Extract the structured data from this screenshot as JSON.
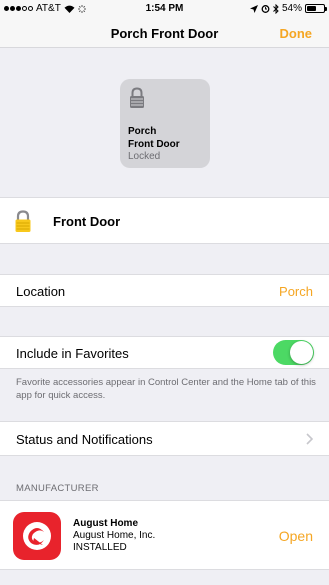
{
  "status_bar": {
    "carrier": "AT&T",
    "time": "1:54 PM",
    "battery": "54%",
    "battery_level": 0.54,
    "icons": [
      "signal-dots-icon",
      "wifi-icon",
      "activity-spinner-icon",
      "location-arrow-icon",
      "alarm-icon",
      "bluetooth-icon",
      "battery-icon"
    ]
  },
  "nav": {
    "title": "Porch Front Door",
    "done_label": "Done"
  },
  "tile": {
    "icon": "lock-icon",
    "name_line1": "Porch",
    "name_line2": "Front Door",
    "state": "Locked"
  },
  "accessory": {
    "icon": "lock-icon",
    "name": "Front Door"
  },
  "location": {
    "label": "Location",
    "value": "Porch"
  },
  "favorites": {
    "label": "Include in Favorites",
    "enabled": true,
    "footer": "Favorite accessories appear in Control Center and the Home tab of this app for quick access."
  },
  "status_notifications": {
    "label": "Status and Notifications"
  },
  "manufacturer": {
    "section_title": "MANUFACTURER",
    "app_name": "August Home",
    "company": "August Home, Inc.",
    "install_state": "INSTALLED",
    "open_label": "Open"
  },
  "colors": {
    "accent": "#f5a623",
    "toggle_on": "#4cd964",
    "app_icon": "#e8232c",
    "lock_yellow": "#f8c81c"
  }
}
